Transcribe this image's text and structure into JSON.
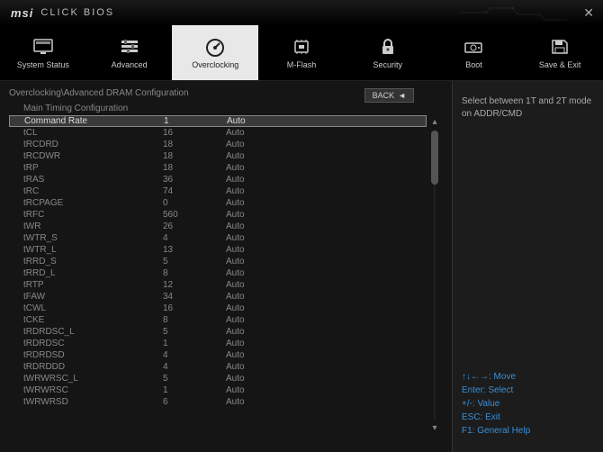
{
  "brand": "msi",
  "product": "CLICK BIOS",
  "nav": [
    {
      "label": "System Status"
    },
    {
      "label": "Advanced"
    },
    {
      "label": "Overclocking"
    },
    {
      "label": "M-Flash"
    },
    {
      "label": "Security"
    },
    {
      "label": "Boot"
    },
    {
      "label": "Save & Exit"
    }
  ],
  "breadcrumb": "Overclocking\\Advanced DRAM Configuration",
  "back_label": "BACK",
  "section_title": "Main Timing Configuration",
  "rows": [
    {
      "name": "Command Rate",
      "val": "1",
      "mode": "Auto",
      "selected": true
    },
    {
      "name": "tCL",
      "val": "16",
      "mode": "Auto"
    },
    {
      "name": "tRCDRD",
      "val": "18",
      "mode": "Auto"
    },
    {
      "name": "tRCDWR",
      "val": "18",
      "mode": "Auto"
    },
    {
      "name": "tRP",
      "val": "18",
      "mode": "Auto"
    },
    {
      "name": "tRAS",
      "val": "36",
      "mode": "Auto"
    },
    {
      "name": "tRC",
      "val": "74",
      "mode": "Auto"
    },
    {
      "name": "tRCPAGE",
      "val": "0",
      "mode": "Auto"
    },
    {
      "name": "tRFC",
      "val": "560",
      "mode": "Auto"
    },
    {
      "name": "tWR",
      "val": "26",
      "mode": "Auto"
    },
    {
      "name": "tWTR_S",
      "val": "4",
      "mode": "Auto"
    },
    {
      "name": "tWTR_L",
      "val": "13",
      "mode": "Auto"
    },
    {
      "name": "tRRD_S",
      "val": "5",
      "mode": "Auto"
    },
    {
      "name": "tRRD_L",
      "val": "8",
      "mode": "Auto"
    },
    {
      "name": "tRTP",
      "val": "12",
      "mode": "Auto"
    },
    {
      "name": "tFAW",
      "val": "34",
      "mode": "Auto"
    },
    {
      "name": "tCWL",
      "val": "16",
      "mode": "Auto"
    },
    {
      "name": "tCKE",
      "val": "8",
      "mode": "Auto"
    },
    {
      "name": "tRDRDSC_L",
      "val": "5",
      "mode": "Auto"
    },
    {
      "name": "tRDRDSC",
      "val": "1",
      "mode": "Auto"
    },
    {
      "name": "tRDRDSD",
      "val": "4",
      "mode": "Auto"
    },
    {
      "name": "tRDRDDD",
      "val": "4",
      "mode": "Auto"
    },
    {
      "name": "tWRWRSC_L",
      "val": "5",
      "mode": "Auto"
    },
    {
      "name": "tWRWRSC",
      "val": "1",
      "mode": "Auto"
    },
    {
      "name": "tWRWRSD",
      "val": "6",
      "mode": "Auto"
    }
  ],
  "help_text": "Select between 1T and 2T mode on ADDR/CMD",
  "keys": {
    "move": "↑↓←→: Move",
    "enter": "Enter: Select",
    "value": "+/-: Value",
    "esc": "ESC: Exit",
    "f1": "F1: General Help"
  }
}
